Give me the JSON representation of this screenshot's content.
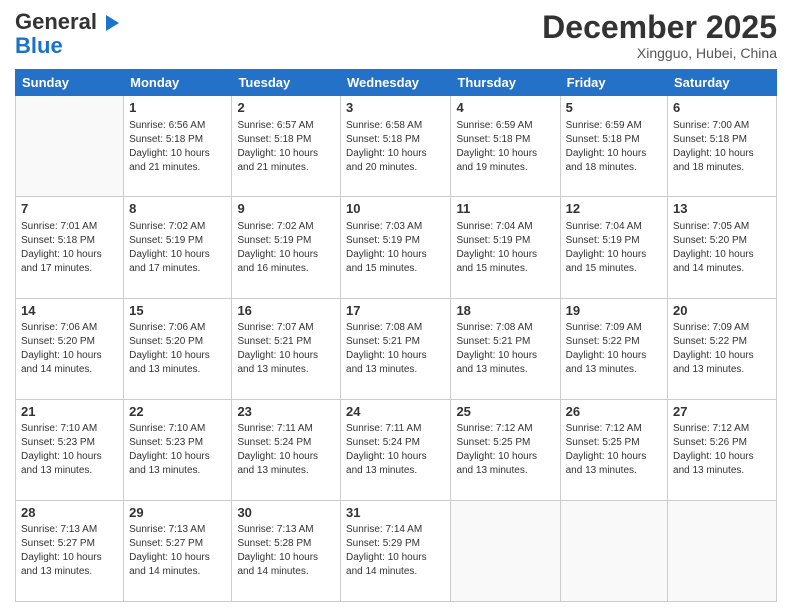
{
  "header": {
    "logo_line1": "General",
    "logo_line2": "Blue",
    "month": "December 2025",
    "location": "Xingguo, Hubei, China"
  },
  "weekdays": [
    "Sunday",
    "Monday",
    "Tuesday",
    "Wednesday",
    "Thursday",
    "Friday",
    "Saturday"
  ],
  "weeks": [
    [
      {
        "day": "",
        "content": ""
      },
      {
        "day": "1",
        "content": "Sunrise: 6:56 AM\nSunset: 5:18 PM\nDaylight: 10 hours\nand 21 minutes."
      },
      {
        "day": "2",
        "content": "Sunrise: 6:57 AM\nSunset: 5:18 PM\nDaylight: 10 hours\nand 21 minutes."
      },
      {
        "day": "3",
        "content": "Sunrise: 6:58 AM\nSunset: 5:18 PM\nDaylight: 10 hours\nand 20 minutes."
      },
      {
        "day": "4",
        "content": "Sunrise: 6:59 AM\nSunset: 5:18 PM\nDaylight: 10 hours\nand 19 minutes."
      },
      {
        "day": "5",
        "content": "Sunrise: 6:59 AM\nSunset: 5:18 PM\nDaylight: 10 hours\nand 18 minutes."
      },
      {
        "day": "6",
        "content": "Sunrise: 7:00 AM\nSunset: 5:18 PM\nDaylight: 10 hours\nand 18 minutes."
      }
    ],
    [
      {
        "day": "7",
        "content": "Sunrise: 7:01 AM\nSunset: 5:18 PM\nDaylight: 10 hours\nand 17 minutes."
      },
      {
        "day": "8",
        "content": "Sunrise: 7:02 AM\nSunset: 5:19 PM\nDaylight: 10 hours\nand 17 minutes."
      },
      {
        "day": "9",
        "content": "Sunrise: 7:02 AM\nSunset: 5:19 PM\nDaylight: 10 hours\nand 16 minutes."
      },
      {
        "day": "10",
        "content": "Sunrise: 7:03 AM\nSunset: 5:19 PM\nDaylight: 10 hours\nand 15 minutes."
      },
      {
        "day": "11",
        "content": "Sunrise: 7:04 AM\nSunset: 5:19 PM\nDaylight: 10 hours\nand 15 minutes."
      },
      {
        "day": "12",
        "content": "Sunrise: 7:04 AM\nSunset: 5:19 PM\nDaylight: 10 hours\nand 15 minutes."
      },
      {
        "day": "13",
        "content": "Sunrise: 7:05 AM\nSunset: 5:20 PM\nDaylight: 10 hours\nand 14 minutes."
      }
    ],
    [
      {
        "day": "14",
        "content": "Sunrise: 7:06 AM\nSunset: 5:20 PM\nDaylight: 10 hours\nand 14 minutes."
      },
      {
        "day": "15",
        "content": "Sunrise: 7:06 AM\nSunset: 5:20 PM\nDaylight: 10 hours\nand 13 minutes."
      },
      {
        "day": "16",
        "content": "Sunrise: 7:07 AM\nSunset: 5:21 PM\nDaylight: 10 hours\nand 13 minutes."
      },
      {
        "day": "17",
        "content": "Sunrise: 7:08 AM\nSunset: 5:21 PM\nDaylight: 10 hours\nand 13 minutes."
      },
      {
        "day": "18",
        "content": "Sunrise: 7:08 AM\nSunset: 5:21 PM\nDaylight: 10 hours\nand 13 minutes."
      },
      {
        "day": "19",
        "content": "Sunrise: 7:09 AM\nSunset: 5:22 PM\nDaylight: 10 hours\nand 13 minutes."
      },
      {
        "day": "20",
        "content": "Sunrise: 7:09 AM\nSunset: 5:22 PM\nDaylight: 10 hours\nand 13 minutes."
      }
    ],
    [
      {
        "day": "21",
        "content": "Sunrise: 7:10 AM\nSunset: 5:23 PM\nDaylight: 10 hours\nand 13 minutes."
      },
      {
        "day": "22",
        "content": "Sunrise: 7:10 AM\nSunset: 5:23 PM\nDaylight: 10 hours\nand 13 minutes."
      },
      {
        "day": "23",
        "content": "Sunrise: 7:11 AM\nSunset: 5:24 PM\nDaylight: 10 hours\nand 13 minutes."
      },
      {
        "day": "24",
        "content": "Sunrise: 7:11 AM\nSunset: 5:24 PM\nDaylight: 10 hours\nand 13 minutes."
      },
      {
        "day": "25",
        "content": "Sunrise: 7:12 AM\nSunset: 5:25 PM\nDaylight: 10 hours\nand 13 minutes."
      },
      {
        "day": "26",
        "content": "Sunrise: 7:12 AM\nSunset: 5:25 PM\nDaylight: 10 hours\nand 13 minutes."
      },
      {
        "day": "27",
        "content": "Sunrise: 7:12 AM\nSunset: 5:26 PM\nDaylight: 10 hours\nand 13 minutes."
      }
    ],
    [
      {
        "day": "28",
        "content": "Sunrise: 7:13 AM\nSunset: 5:27 PM\nDaylight: 10 hours\nand 13 minutes."
      },
      {
        "day": "29",
        "content": "Sunrise: 7:13 AM\nSunset: 5:27 PM\nDaylight: 10 hours\nand 14 minutes."
      },
      {
        "day": "30",
        "content": "Sunrise: 7:13 AM\nSunset: 5:28 PM\nDaylight: 10 hours\nand 14 minutes."
      },
      {
        "day": "31",
        "content": "Sunrise: 7:14 AM\nSunset: 5:29 PM\nDaylight: 10 hours\nand 14 minutes."
      },
      {
        "day": "",
        "content": ""
      },
      {
        "day": "",
        "content": ""
      },
      {
        "day": "",
        "content": ""
      }
    ]
  ]
}
